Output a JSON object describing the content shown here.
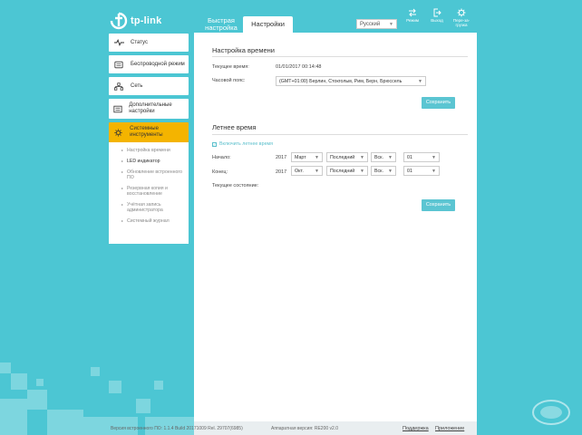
{
  "brand": {
    "name": "tp-link"
  },
  "header": {
    "tabs": [
      {
        "label": "Быстрая настройка"
      },
      {
        "label": "Настройки"
      }
    ],
    "language": "Русский",
    "buttons": {
      "mode": "Режим",
      "logout": "Выход",
      "reboot": "Пере-за-грузка"
    }
  },
  "sidebar": {
    "items": [
      {
        "label": "Статус",
        "icon": "pulse-icon"
      },
      {
        "label": "Беспроводной режим",
        "icon": "wifi-icon"
      },
      {
        "label": "Сеть",
        "icon": "network-icon"
      },
      {
        "label": "Дополнительные настройки",
        "icon": "sliders-icon"
      },
      {
        "label": "Системные инструменты",
        "icon": "gear-icon"
      }
    ],
    "submenu": [
      "Настройка времени",
      "LED индикатор",
      "Обновление встроенного ПО",
      "Резервная копия и восстановление",
      "Учётная запись администратора",
      "Системный журнал"
    ]
  },
  "time_settings": {
    "title": "Настройка времени",
    "current_time_label": "Текущее время:",
    "current_time_value": "01/01/2017 00:14:48",
    "timezone_label": "Часовой пояс:",
    "timezone_value": "(GMT+01:00) Берлин, Стокгольм, Рим, Берн, Брюссель",
    "save_label": "Сохранить"
  },
  "dst": {
    "title": "Летнее время",
    "enable_label": "Включить летнее время",
    "start_label": "Начало:",
    "start": {
      "year": "2017",
      "month": "Март",
      "week": "Последний",
      "day": "Вск.",
      "hour": "01"
    },
    "end_label": "Конец:",
    "end": {
      "year": "2017",
      "month": "Окт.",
      "week": "Последний",
      "day": "Вск.",
      "hour": "01"
    },
    "status_label": "Текущее состояние:",
    "save_label": "Сохранить"
  },
  "footer": {
    "firmware": "Версия встроенного ПО: 1.1.4 Build 20171009 Rel. 29707(6985)",
    "hardware": "Аппаратная версия: RE200 v2.0",
    "support": "Поддержка",
    "app": "Приложение"
  },
  "colors": {
    "background": "#4cc6d3",
    "accent": "#5bc5d2",
    "active": "#f4b400"
  }
}
